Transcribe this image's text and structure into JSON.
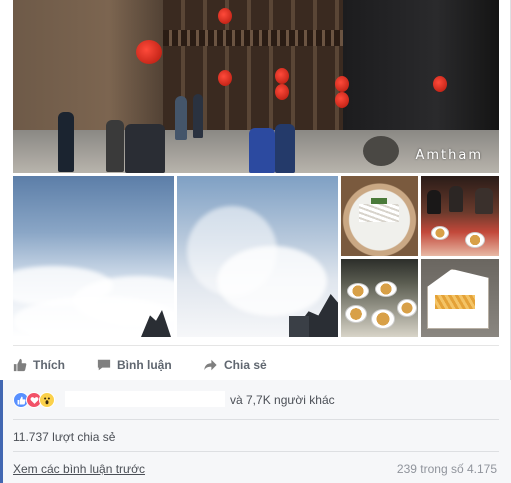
{
  "photos": {
    "main_watermark": "Amtham",
    "main_alt": "courtyard-photo",
    "sky1_alt": "cloud-sea-photo",
    "sky2_alt": "mountain-mist-photo",
    "food1_alt": "noodle-bowl-photo",
    "food2_alt": "dinner-table-photo",
    "food3_alt": "dishes-photo",
    "food4_alt": "takeout-box-photo"
  },
  "actions": {
    "like_label": "Thích",
    "comment_label": "Bình luận",
    "share_label": "Chia sẻ",
    "like_icon": "thumbs-up-icon",
    "comment_icon": "comment-icon",
    "share_icon": "share-arrow-icon"
  },
  "social": {
    "reaction_icons": [
      "like-reaction-icon",
      "love-reaction-icon",
      "wow-reaction-icon"
    ],
    "reaction_text": "và 7,7K người khác",
    "share_count_text": "11.737 lượt chia sẻ",
    "view_previous_comments": "Xem các bình luận trước",
    "comment_count_text": "239 trong số 4.175"
  },
  "colors": {
    "accent": "#4267b2",
    "like": "#5890ff",
    "love": "#f25268",
    "wow": "#fbd14b"
  }
}
